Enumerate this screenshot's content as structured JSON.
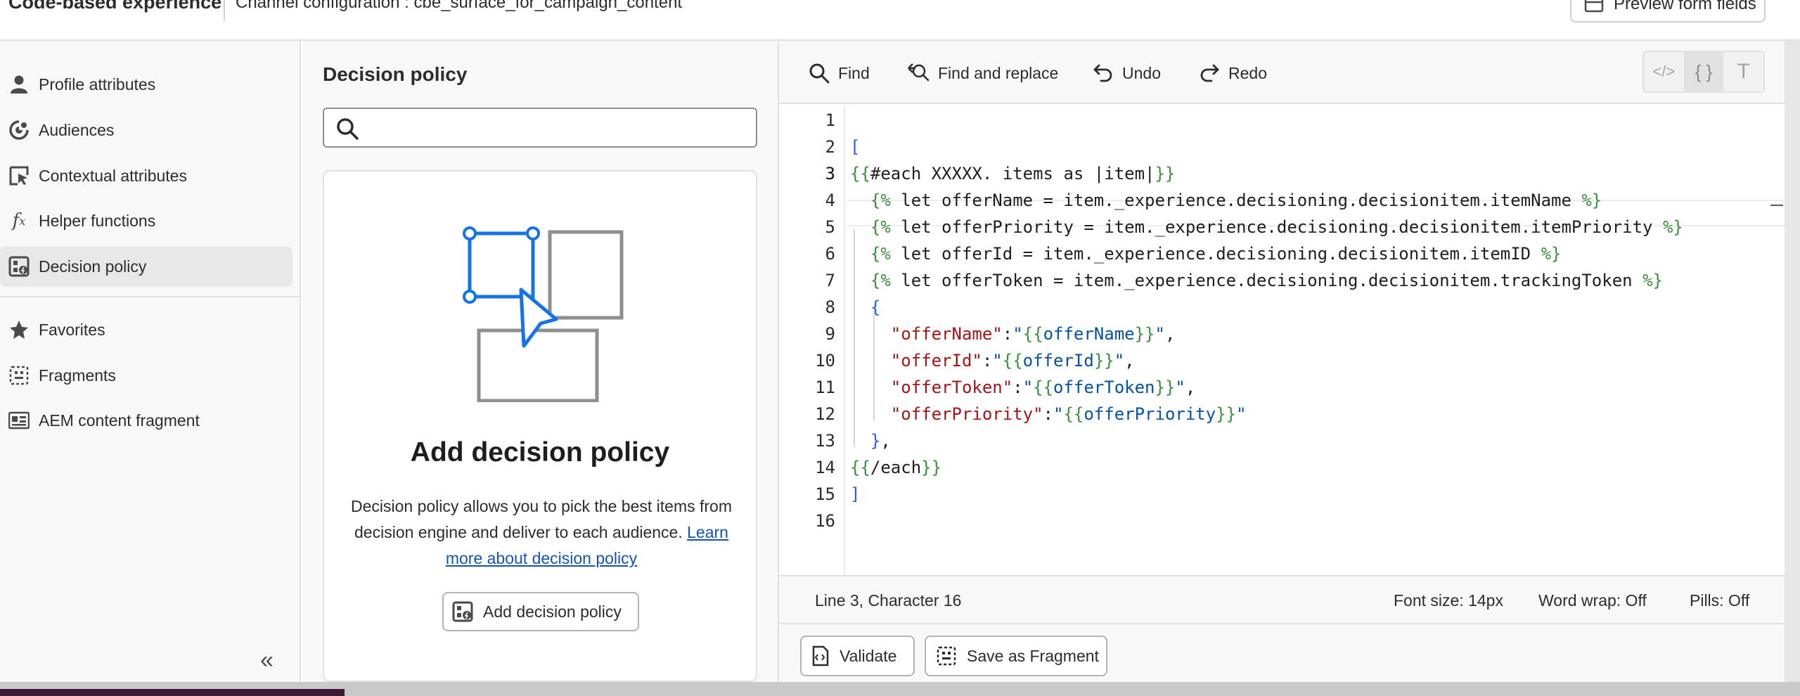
{
  "header": {
    "title": "Code-based experience",
    "channel": "Channel configuration : cbe_surface_for_campaign_content",
    "preview_button": "Preview form fields"
  },
  "sidebar": {
    "items": [
      {
        "label": "Profile attributes",
        "icon": "person-icon"
      },
      {
        "label": "Audiences",
        "icon": "audiences-icon"
      },
      {
        "label": "Contextual attributes",
        "icon": "contextual-icon"
      },
      {
        "label": "Helper functions",
        "icon": "function-icon"
      },
      {
        "label": "Decision policy",
        "icon": "decision-icon",
        "active": true
      },
      {
        "label": "Favorites",
        "icon": "star-icon"
      },
      {
        "label": "Fragments",
        "icon": "fragment-icon"
      },
      {
        "label": "AEM content fragment",
        "icon": "aem-icon"
      }
    ],
    "collapse_glyph": "«"
  },
  "panel": {
    "title": "Decision policy",
    "search_placeholder": "",
    "card": {
      "title": "Add decision policy",
      "description": "Decision policy allows you to pick the best items from decision engine and deliver to each audience.",
      "link": "Learn more about decision policy",
      "button": "Add decision policy"
    }
  },
  "editor": {
    "toolbar": {
      "find": "Find",
      "find_replace": "Find and replace",
      "undo": "Undo",
      "redo": "Redo"
    },
    "mode_icons": [
      "</>",
      "{ }",
      "T"
    ],
    "active_line": 3,
    "lines": [
      "",
      "[",
      "{{#each XXXXX. items as |item|}}",
      "  {% let offerName = item._experience.decisioning.decisionitem.itemName %}",
      "  {% let offerPriority = item._experience.decisioning.decisionitem.itemPriority %}",
      "  {% let offerId = item._experience.decisioning.decisionitem.itemID %}",
      "  {% let offerToken = item._experience.decisioning.decisionitem.trackingToken %}",
      "  {",
      "    \"offerName\":\"{{offerName}}\",",
      "    \"offerId\":\"{{offerId}}\",",
      "    \"offerToken\":\"{{offerToken}}\",",
      "    \"offerPriority\":\"{{offerPriority}}\"",
      "  },",
      "{{/each}}",
      "]",
      ""
    ],
    "status": {
      "position": "Line 3, Character 16",
      "font_size": "Font size: 14px",
      "word_wrap": "Word wrap: Off",
      "pills": "Pills: Off"
    },
    "actions": {
      "validate": "Validate",
      "save_fragment": "Save as Fragment"
    }
  },
  "colors": {
    "accent": "#1473e6",
    "link": "#1552b8",
    "json_key": "#a31515",
    "json_string": "#0451a5",
    "bracket": "#3b8e3b"
  }
}
